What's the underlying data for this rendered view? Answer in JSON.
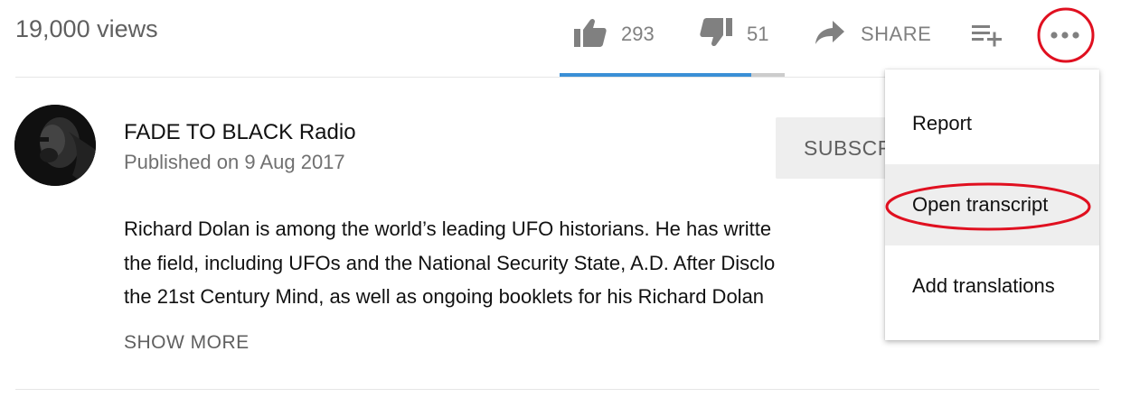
{
  "stats": {
    "views": "19,000 views"
  },
  "actions": {
    "like_count": "293",
    "dislike_count": "51",
    "share_label": "SHARE",
    "save_icon": "playlist-add-icon",
    "more_icon": "more-horizontal-icon"
  },
  "sentiment": {
    "like_ratio": 0.85,
    "like_color": "#3a8fd6",
    "dislike_color": "#cccccc"
  },
  "channel": {
    "name": "FADE TO BLACK Radio",
    "published": "Published on 9 Aug 2017",
    "subscribe_label": "SUBSCR"
  },
  "description": {
    "lines": [
      "Richard Dolan is among the world’s leading UFO historians. He has writte",
      "the field, including UFOs and the National Security State, A.D. After Disclo",
      "the 21st Century Mind, as well as ongoing booklets for his Richard Dolan"
    ],
    "show_more": "SHOW MORE"
  },
  "menu": {
    "items": [
      {
        "label": "Report"
      },
      {
        "label": "Open transcript",
        "highlighted": true
      },
      {
        "label": "Add translations"
      }
    ]
  },
  "annotation_color": "#e01020"
}
